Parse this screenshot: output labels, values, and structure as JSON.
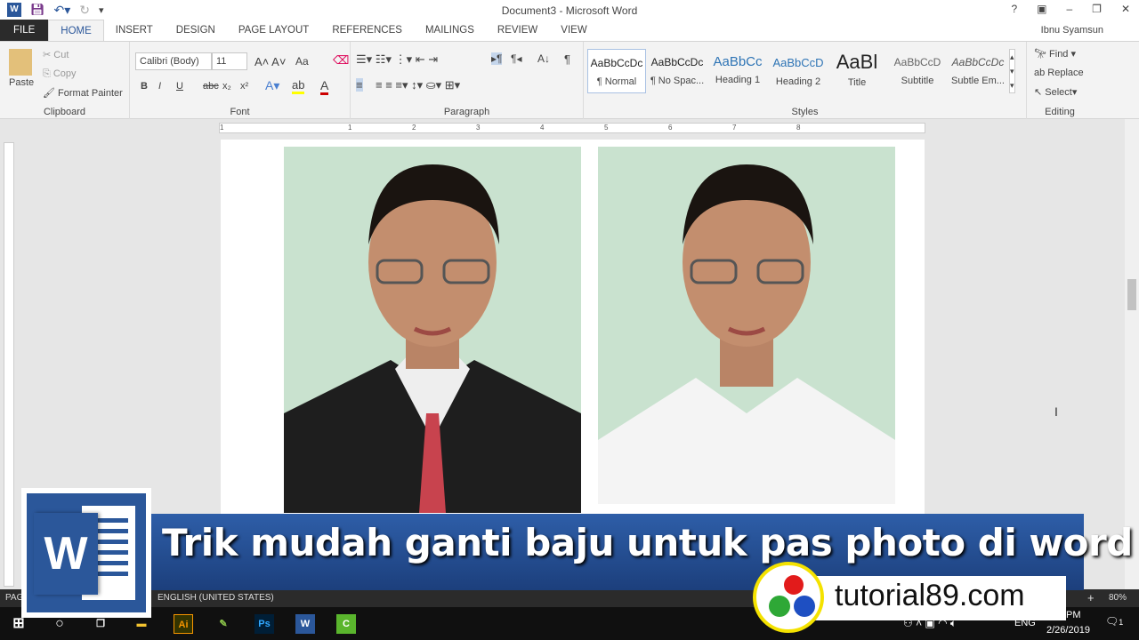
{
  "window": {
    "title": "Document3 - Microsoft Word",
    "user": "Ibnu Syamsun",
    "help": "?"
  },
  "tabs": [
    "FILE",
    "HOME",
    "INSERT",
    "DESIGN",
    "PAGE LAYOUT",
    "REFERENCES",
    "MAILINGS",
    "REVIEW",
    "VIEW"
  ],
  "clipboard": {
    "paste": "Paste",
    "cut": "Cut",
    "copy": "Copy",
    "format_painter": "Format Painter",
    "label": "Clipboard"
  },
  "font": {
    "name": "Calibri (Body)",
    "size": "11",
    "change_case": "Aa",
    "bold": "B",
    "italic": "I",
    "underline": "U",
    "strike": "abc",
    "sub": "x₂",
    "sup": "x²",
    "label": "Font"
  },
  "paragraph": {
    "label": "Paragraph",
    "pilcrow": "¶"
  },
  "styles": {
    "label": "Styles",
    "items": [
      {
        "preview": "AaBbCcDc",
        "name": "¶ Normal"
      },
      {
        "preview": "AaBbCcDc",
        "name": "¶ No Spac..."
      },
      {
        "preview": "AaBbCc",
        "name": "Heading 1"
      },
      {
        "preview": "AaBbCcD",
        "name": "Heading 2"
      },
      {
        "preview": "AaBl",
        "name": "Title"
      },
      {
        "preview": "AaBbCcD",
        "name": "Subtitle"
      },
      {
        "preview": "AaBbCcDc",
        "name": "Subtle Em..."
      }
    ]
  },
  "editing": {
    "label": "Editing",
    "find": "Find",
    "replace": "Replace",
    "select": "Select"
  },
  "ruler": [
    "1",
    "1",
    "2",
    "3",
    "4",
    "5",
    "6",
    "7",
    "8"
  ],
  "status": {
    "page": "PAG",
    "language": "ENGLISH (UNITED STATES)",
    "zoom": "80%"
  },
  "banner": {
    "title": "Trik mudah ganti baju untuk pas photo di word",
    "site": "tutorial89.com",
    "logo_letter": "W"
  },
  "taskbar": {
    "time": "PM",
    "date": "2/26/2019",
    "lang": "ENG",
    "notif": "1",
    "apps": [
      "Ai",
      "Ps",
      "W",
      "C"
    ]
  }
}
